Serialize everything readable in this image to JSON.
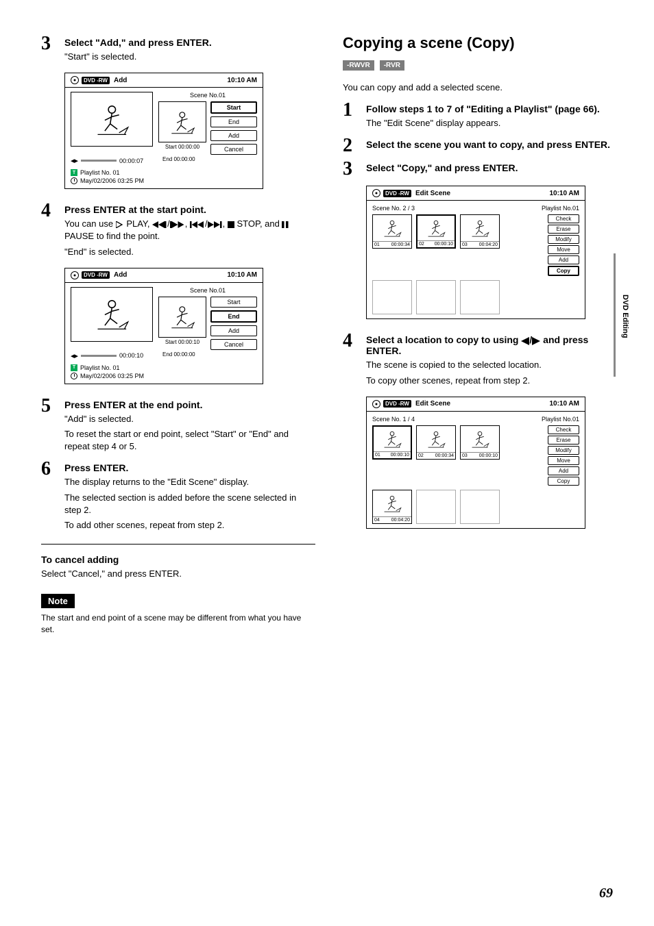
{
  "left": {
    "step3": {
      "title": "Select \"Add,\" and press ENTER.",
      "text": "\"Start\" is selected."
    },
    "panel_add1": {
      "title": "Add",
      "time": "10:10 AM",
      "scene": "Scene No.01",
      "start_time": "Start 00:00:00",
      "end_time": "End   00:00:00",
      "tl_time": "00:00:07",
      "playlist": "Playlist No. 01",
      "date": "May/02/2006  03:25  PM",
      "btn_start": "Start",
      "btn_end": "End",
      "btn_add": "Add",
      "btn_cancel": "Cancel"
    },
    "step4": {
      "title": "Press ENTER at the start point.",
      "line1a": "You can use ",
      "line1b": " PLAY, ",
      "line1c": ", ",
      "line2a": ", ",
      "line2b": " STOP, and ",
      "line2c": " PAUSE to find the point.",
      "line3": "\"End\" is selected."
    },
    "panel_add2": {
      "title": "Add",
      "time": "10:10 AM",
      "scene": "Scene No.01",
      "start_time": "Start 00:00:10",
      "end_time": "End   00:00:00",
      "tl_time": "00:00:10",
      "playlist": "Playlist No. 01",
      "date": "May/02/2006  03:25  PM",
      "btn_start": "Start",
      "btn_end": "End",
      "btn_add": "Add",
      "btn_cancel": "Cancel"
    },
    "step5": {
      "title": "Press ENTER at the end point.",
      "text1": "\"Add\" is selected.",
      "text2": "To reset the start or end point, select \"Start\" or \"End\" and repeat step 4 or 5."
    },
    "step6": {
      "title": "Press ENTER.",
      "text1": "The display returns to the \"Edit Scene\" display.",
      "text2": "The selected section is added before the scene selected in step 2.",
      "text3": "To add other scenes, repeat from step 2."
    },
    "cancel_head": "To cancel adding",
    "cancel_text": "Select \"Cancel,\" and press ENTER.",
    "note_label": "Note",
    "note_text": "The start and end point of a scene may be different from what you have set."
  },
  "right": {
    "section": "Copying a scene (Copy)",
    "fmt1": "-RWVR",
    "fmt2": "-RVR",
    "intro": "You can copy and add a selected scene.",
    "step1": {
      "title": "Follow steps 1 to 7 of \"Editing a Playlist\" (page 66).",
      "text": "The \"Edit Scene\" display appears."
    },
    "step2": {
      "title": "Select the scene you want to copy, and press ENTER."
    },
    "step3": {
      "title": "Select \"Copy,\" and press ENTER."
    },
    "panel_edit1": {
      "title": "Edit Scene",
      "time": "10:10 AM",
      "counter": "Scene No. 2 / 3",
      "playlist": "Playlist No.01",
      "thumbs": [
        {
          "n": "01",
          "t": "00:00:34"
        },
        {
          "n": "02",
          "t": "00:00:10"
        },
        {
          "n": "03",
          "t": "00:04:20"
        }
      ],
      "btns": [
        "Check",
        "Erase",
        "Modify",
        "Move",
        "Add",
        "Copy"
      ]
    },
    "step4": {
      "title_a": "Select a location to copy to using ",
      "title_b": " and press ENTER.",
      "text1": "The scene is copied to the selected location.",
      "text2": "To copy other scenes, repeat from step 2."
    },
    "panel_edit2": {
      "title": "Edit Scene",
      "time": "10:10 AM",
      "counter": "Scene No. 1 / 4",
      "playlist": "Playlist No.01",
      "thumbs_r1": [
        {
          "n": "01",
          "t": "00:00:10"
        },
        {
          "n": "02",
          "t": "00:00:34"
        },
        {
          "n": "03",
          "t": "00:00:10"
        }
      ],
      "thumbs_r2": [
        {
          "n": "04",
          "t": "00:04:20"
        }
      ],
      "btns": [
        "Check",
        "Erase",
        "Modify",
        "Move",
        "Add",
        "Copy"
      ]
    }
  },
  "side_tab": "DVD Editing",
  "page_num": "69",
  "dvd_badge": "DVD -RW"
}
